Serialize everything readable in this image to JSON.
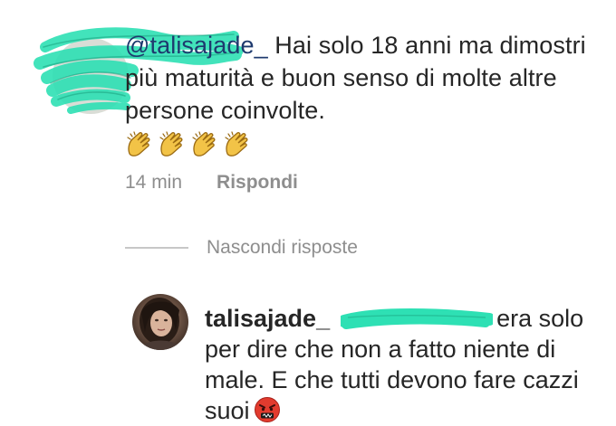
{
  "comment": {
    "mention": "@talisajade_",
    "text": " Hai solo 18 anni ma dimostri più maturità e buon senso di molte altre persone coinvolte.",
    "emoji_icon": "clapping-hands-icon",
    "emoji_count": 4,
    "time": "14 min",
    "reply_label": "Rispondi"
  },
  "hide_replies": {
    "label": "Nascondi risposte"
  },
  "reply": {
    "username": "talisajade_",
    "text": "era solo per dire che non a fatto niente di male. E che tutti devono fare cazzi suoi",
    "emoji_icon": "angry-face-icon"
  },
  "colors": {
    "scribble": "#2ee0b4",
    "meta_gray": "#8e8e8e",
    "text": "#262626",
    "mention": "#1e3a6e"
  }
}
